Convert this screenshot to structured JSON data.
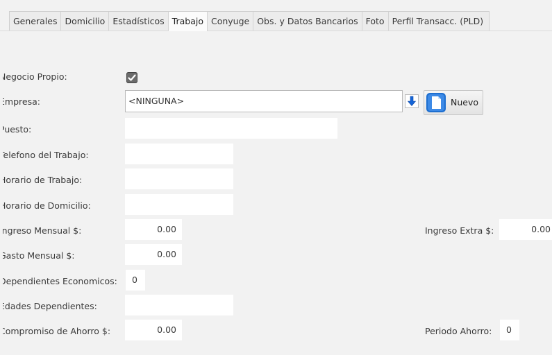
{
  "tabs": {
    "items": [
      {
        "label": "Generales"
      },
      {
        "label": "Domicilio"
      },
      {
        "label": "Estadísticos"
      },
      {
        "label": "Trabajo"
      },
      {
        "label": "Conyuge"
      },
      {
        "label": "Obs. y Datos Bancarios"
      },
      {
        "label": "Foto"
      },
      {
        "label": "Perfil Transacc. (PLD)"
      }
    ],
    "active": "Trabajo"
  },
  "form": {
    "negocio_propio": {
      "label": "Negocio Propio:",
      "checked": true
    },
    "empresa": {
      "label": "Empresa:",
      "value": "<NINGUNA>",
      "button_label": "Nuevo"
    },
    "puesto": {
      "label": "Puesto:",
      "value": ""
    },
    "telefono_trabajo": {
      "label": "Telefono del Trabajo:",
      "value": ""
    },
    "horario_trabajo": {
      "label": "Horario de Trabajo:",
      "value": ""
    },
    "horario_domicilio": {
      "label": "Horario de Domicilio:",
      "value": ""
    },
    "ingreso_mensual": {
      "label": "Ingreso Mensual $:",
      "value": "0.00"
    },
    "ingreso_extra": {
      "label": "Ingreso Extra $:",
      "value": "0.00"
    },
    "gasto_mensual": {
      "label": "Gasto Mensual $:",
      "value": "0.00"
    },
    "dependientes": {
      "label": "Dependientes Economicos:",
      "value": "0"
    },
    "edades_dependientes": {
      "label": "Edades Dependientes:",
      "value": ""
    },
    "compromiso_ahorro": {
      "label": "Compromiso de Ahorro $:",
      "value": "0.00"
    },
    "periodo_ahorro": {
      "label": "Periodo Ahorro:",
      "value": "0"
    }
  },
  "colors": {
    "background": "#f2f2f2",
    "field": "#ffffff",
    "arrow_icon": "#1565d8"
  }
}
